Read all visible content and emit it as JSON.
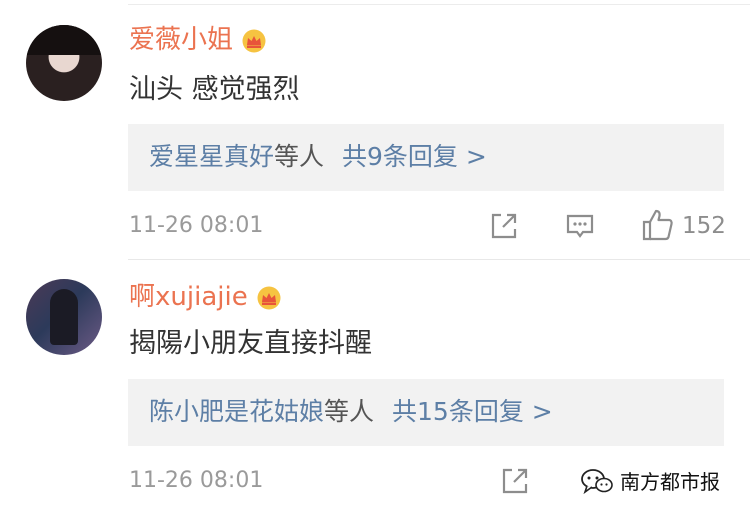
{
  "comments": [
    {
      "username": "爱薇小姐",
      "text": "汕头 感觉强烈",
      "reply_names": "爱星星真好",
      "reply_suffix": "等人",
      "reply_count": "共9条回复 >",
      "timestamp": "11-26 08:01",
      "like_count": "152"
    },
    {
      "username": "啊xujiajie",
      "text": "揭陽小朋友直接抖醒",
      "reply_names": "陈小肥是花姑娘",
      "reply_suffix": "等人",
      "reply_count": "共15条回复 >",
      "timestamp": "11-26 08:01"
    }
  ],
  "watermark": {
    "text": "南方都市报"
  },
  "colors": {
    "username": "#eb7350",
    "link": "#5d7fa6",
    "meta": "#9a9a9a",
    "reply_bg": "#f2f2f2"
  }
}
